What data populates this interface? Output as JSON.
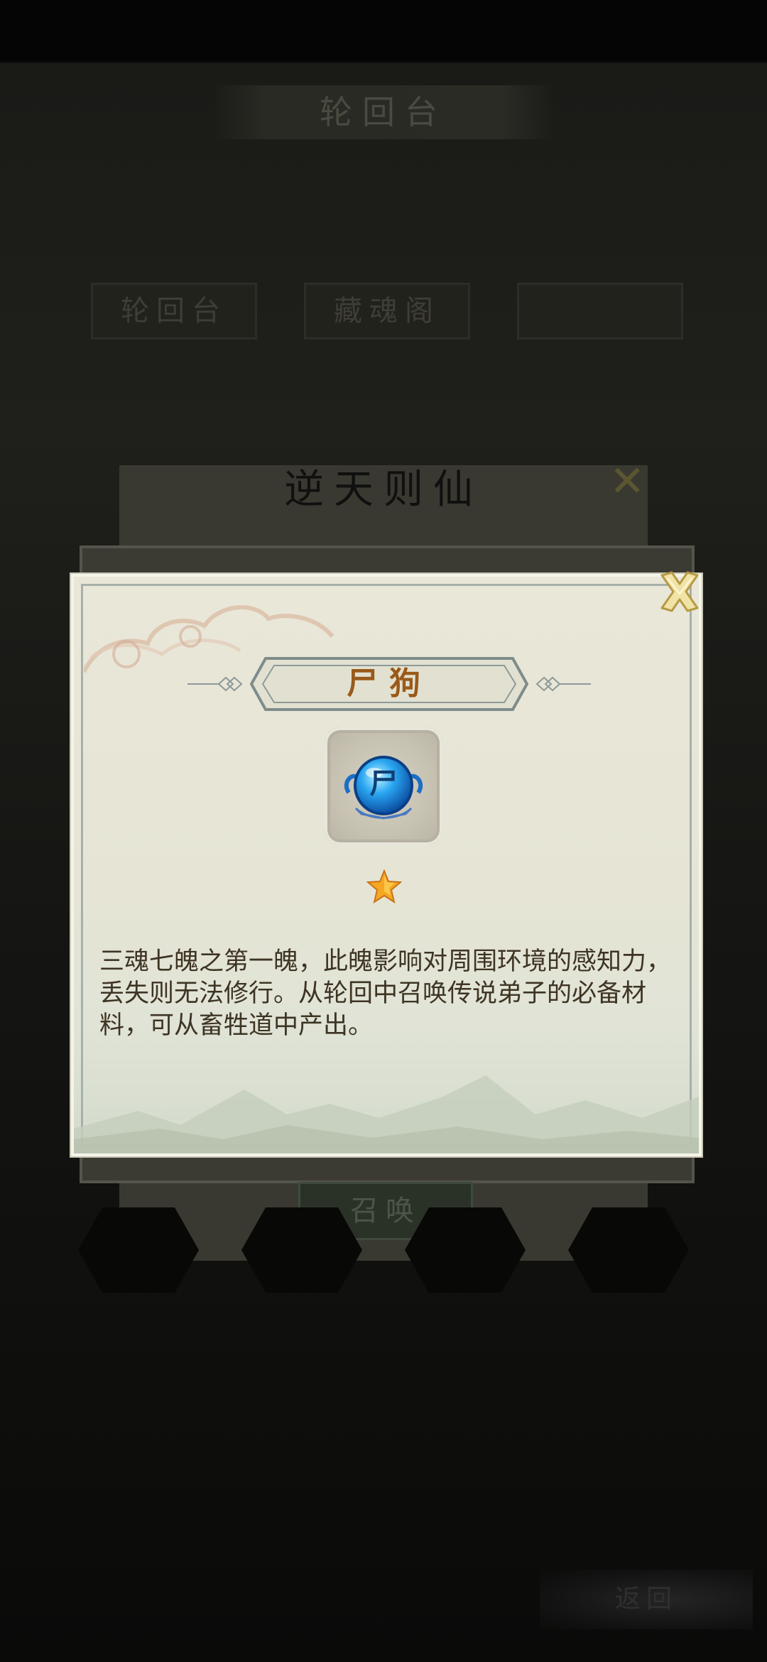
{
  "background": {
    "screen_title": "轮回台",
    "tabs": [
      "轮回台",
      "藏魂阁",
      ""
    ],
    "panel_title": "逆天则仙",
    "summon_button": "召唤",
    "back_button": "返回"
  },
  "modal": {
    "item_name": "尸狗",
    "item_icon_char": "尸",
    "item_icon": "blue-soul-orb-icon",
    "star_count": 1,
    "description": "三魂七魄之第一魄，此魄影响对周围环境的感知力，丢失则无法修行。从轮回中召唤传说弟子的必备材料，可从畜牲道中产出。",
    "close_icon": "close-x-icon"
  },
  "colors": {
    "title_text": "#9a5a1a",
    "description_text": "#3e3424",
    "modal_background": "#e9e7d8",
    "star": "#f5a623",
    "orb": "#1e90e6"
  }
}
